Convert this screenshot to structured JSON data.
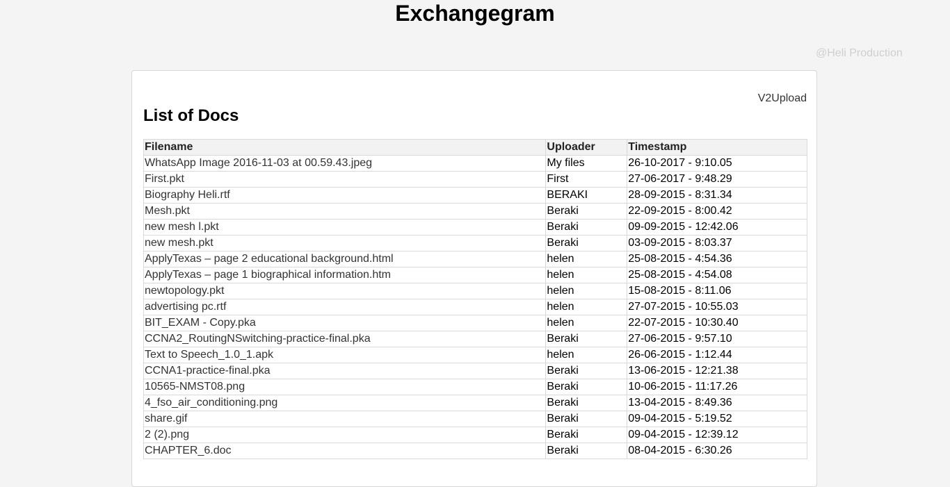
{
  "header": {
    "title": "Exchangegram",
    "credit": "@Heli Production"
  },
  "card": {
    "upload_link": "V2Upload",
    "section_title": "List of Docs"
  },
  "table": {
    "columns": [
      "Filename",
      "Uploader",
      "Timestamp"
    ],
    "rows": [
      {
        "filename": "WhatsApp Image 2016-11-03 at 00.59.43.jpeg",
        "uploader": "My files",
        "timestamp": "26-10-2017 - 9:10.05"
      },
      {
        "filename": "First.pkt",
        "uploader": "First",
        "timestamp": "27-06-2017 - 9:48.29"
      },
      {
        "filename": "Biography Heli.rtf",
        "uploader": "BERAKI",
        "timestamp": "28-09-2015 - 8:31.34"
      },
      {
        "filename": "Mesh.pkt",
        "uploader": "Beraki",
        "timestamp": "22-09-2015 - 8:00.42"
      },
      {
        "filename": "new mesh l.pkt",
        "uploader": "Beraki",
        "timestamp": "09-09-2015 - 12:42.06"
      },
      {
        "filename": "new mesh.pkt",
        "uploader": "Beraki",
        "timestamp": "03-09-2015 - 8:03.37"
      },
      {
        "filename": "ApplyTexas – page 2 educational background.html",
        "uploader": "helen",
        "timestamp": "25-08-2015 - 4:54.36"
      },
      {
        "filename": "ApplyTexas – page 1 biographical information.htm",
        "uploader": "helen",
        "timestamp": "25-08-2015 - 4:54.08"
      },
      {
        "filename": "newtopology.pkt",
        "uploader": "helen",
        "timestamp": "15-08-2015 - 8:11.06"
      },
      {
        "filename": "advertising pc.rtf",
        "uploader": "helen",
        "timestamp": "27-07-2015 - 10:55.03"
      },
      {
        "filename": "BIT_EXAM - Copy.pka",
        "uploader": "helen",
        "timestamp": "22-07-2015 - 10:30.40"
      },
      {
        "filename": "CCNA2_RoutingNSwitching-practice-final.pka",
        "uploader": "Beraki",
        "timestamp": "27-06-2015 - 9:57.10"
      },
      {
        "filename": "Text to Speech_1.0_1.apk",
        "uploader": "helen",
        "timestamp": "26-06-2015 - 1:12.44"
      },
      {
        "filename": "CCNA1-practice-final.pka",
        "uploader": "Beraki",
        "timestamp": "13-06-2015 - 12:21.38"
      },
      {
        "filename": "10565-NMST08.png",
        "uploader": "Beraki",
        "timestamp": "10-06-2015 - 11:17.26"
      },
      {
        "filename": "4_fso_air_conditioning.png",
        "uploader": "Beraki",
        "timestamp": "13-04-2015 - 8:49.36"
      },
      {
        "filename": "share.gif",
        "uploader": "Beraki",
        "timestamp": "09-04-2015 - 5:19.52"
      },
      {
        "filename": "2 (2).png",
        "uploader": "Beraki",
        "timestamp": "09-04-2015 - 12:39.12"
      },
      {
        "filename": "CHAPTER_6.doc",
        "uploader": "Beraki",
        "timestamp": "08-04-2015 - 6:30.26"
      }
    ]
  }
}
